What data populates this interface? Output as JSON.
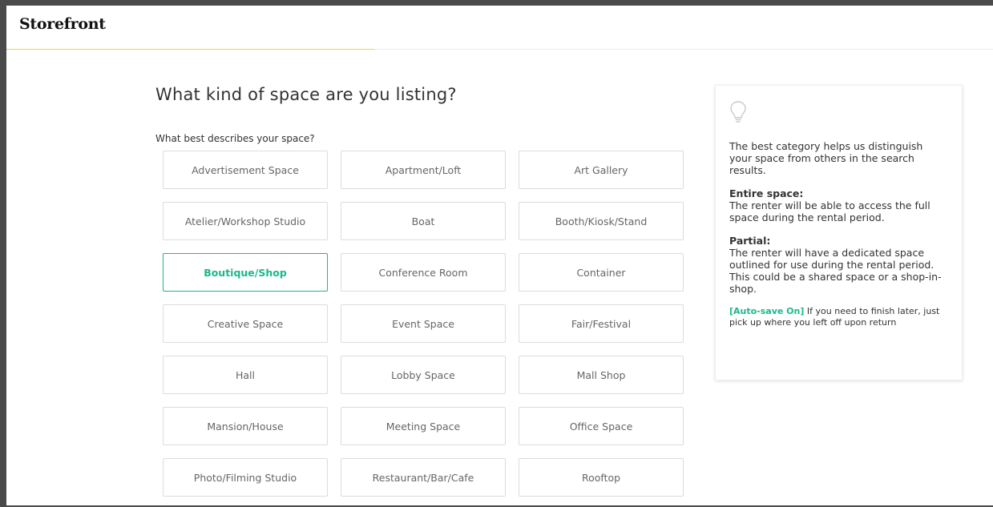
{
  "header": {
    "logo": "Storefront"
  },
  "main": {
    "title": "What kind of space are you listing?",
    "question": "What best describes your space?",
    "selected": "Boutique/Shop",
    "categories": [
      "Advertisement Space",
      "Apartment/Loft",
      "Art Gallery",
      "Atelier/Workshop Studio",
      "Boat",
      "Booth/Kiosk/Stand",
      "Boutique/Shop",
      "Conference Room",
      "Container",
      "Creative Space",
      "Event Space",
      "Fair/Festival",
      "Hall",
      "Lobby Space",
      "Mall Shop",
      "Mansion/House",
      "Meeting Space",
      "Office Space",
      "Photo/Filming Studio",
      "Restaurant/Bar/Cafe",
      "Rooftop"
    ]
  },
  "tip": {
    "icon": "lightbulb-icon",
    "intro": "The best category helps us distinguish your space from others in the search results.",
    "entire_heading": "Entire space:",
    "entire_body": "The renter will be able to access the full space during the rental period.",
    "partial_heading": "Partial:",
    "partial_body": "The renter will have a dedicated space outlined for use during the rental period. This could be a shared space or a shop-in-shop.",
    "autosave_tag": "[Auto-save On]",
    "autosave_text": " If you need to finish later, just pick up where you left off upon return"
  },
  "colors": {
    "accent": "#19b98a",
    "progress": "#f2d23c"
  }
}
